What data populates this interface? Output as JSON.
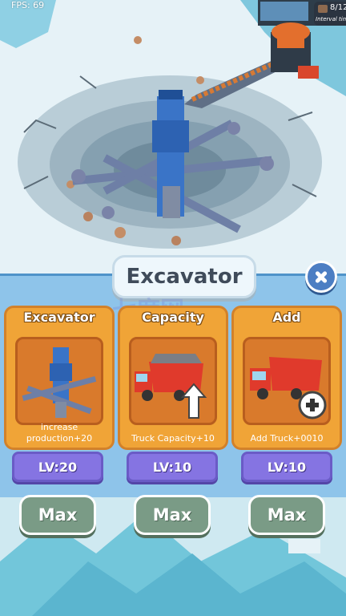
{
  "hud": {
    "fps": "FPS: 69",
    "truck_count": "8/12",
    "interval_label": "Interval time"
  },
  "panel": {
    "title": "Excavator",
    "cards": [
      {
        "title": "Excavator",
        "description": "increase production+20",
        "level": "LV:20",
        "max_label": "Max",
        "icon": "excavator-icon"
      },
      {
        "title": "Capacity",
        "description": "Truck Capacity+10",
        "level": "LV:10",
        "max_label": "Max",
        "icon": "truck-capacity-icon"
      },
      {
        "title": "Add",
        "description": "Add Truck+0010",
        "level": "LV:10",
        "max_label": "Max",
        "icon": "add-truck-icon"
      }
    ],
    "watermark": "七度网"
  },
  "colors": {
    "card_orange": "#f0a437",
    "level_purple": "#8574e2",
    "max_green": "#7a9b86",
    "panel_blue": "#8ec4ea",
    "close_blue": "#4c7ec3"
  }
}
